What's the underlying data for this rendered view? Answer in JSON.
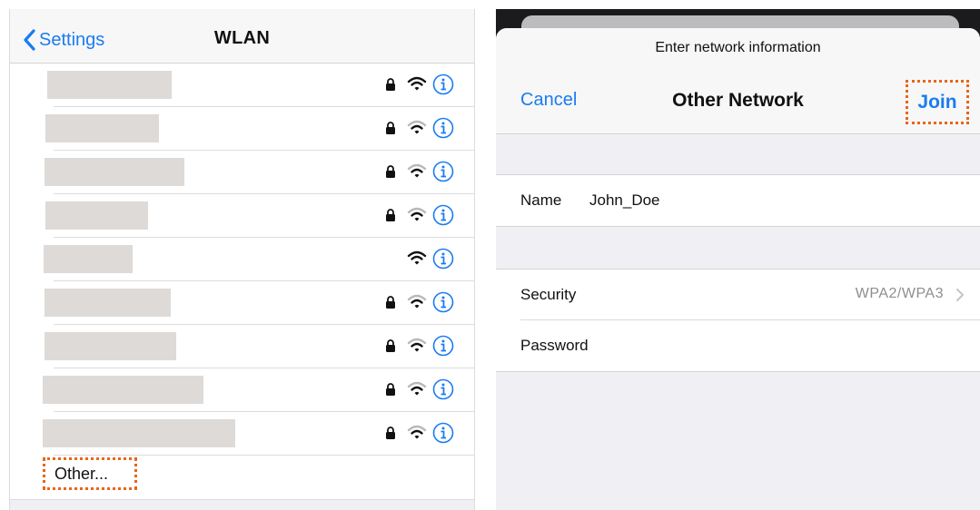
{
  "wlan_screen": {
    "back_label": "Settings",
    "title": "WLAN",
    "networks": [
      {
        "secured": true
      },
      {
        "secured": true
      },
      {
        "secured": true
      },
      {
        "secured": true
      },
      {
        "secured": false
      },
      {
        "secured": true
      },
      {
        "secured": true
      },
      {
        "secured": true
      },
      {
        "secured": true
      }
    ],
    "other_label": "Other..."
  },
  "other_network_sheet": {
    "prompt": "Enter network information",
    "cancel_label": "Cancel",
    "title": "Other Network",
    "join_label": "Join",
    "name_label": "Name",
    "name_value": "John_Doe",
    "security_label": "Security",
    "security_value": "WPA2/WPA3",
    "password_label": "Password"
  },
  "colors": {
    "accent": "#1a7cf0",
    "highlight": "#e9651a",
    "redaction": "#dedad8",
    "grouped_background": "#efeff4"
  }
}
